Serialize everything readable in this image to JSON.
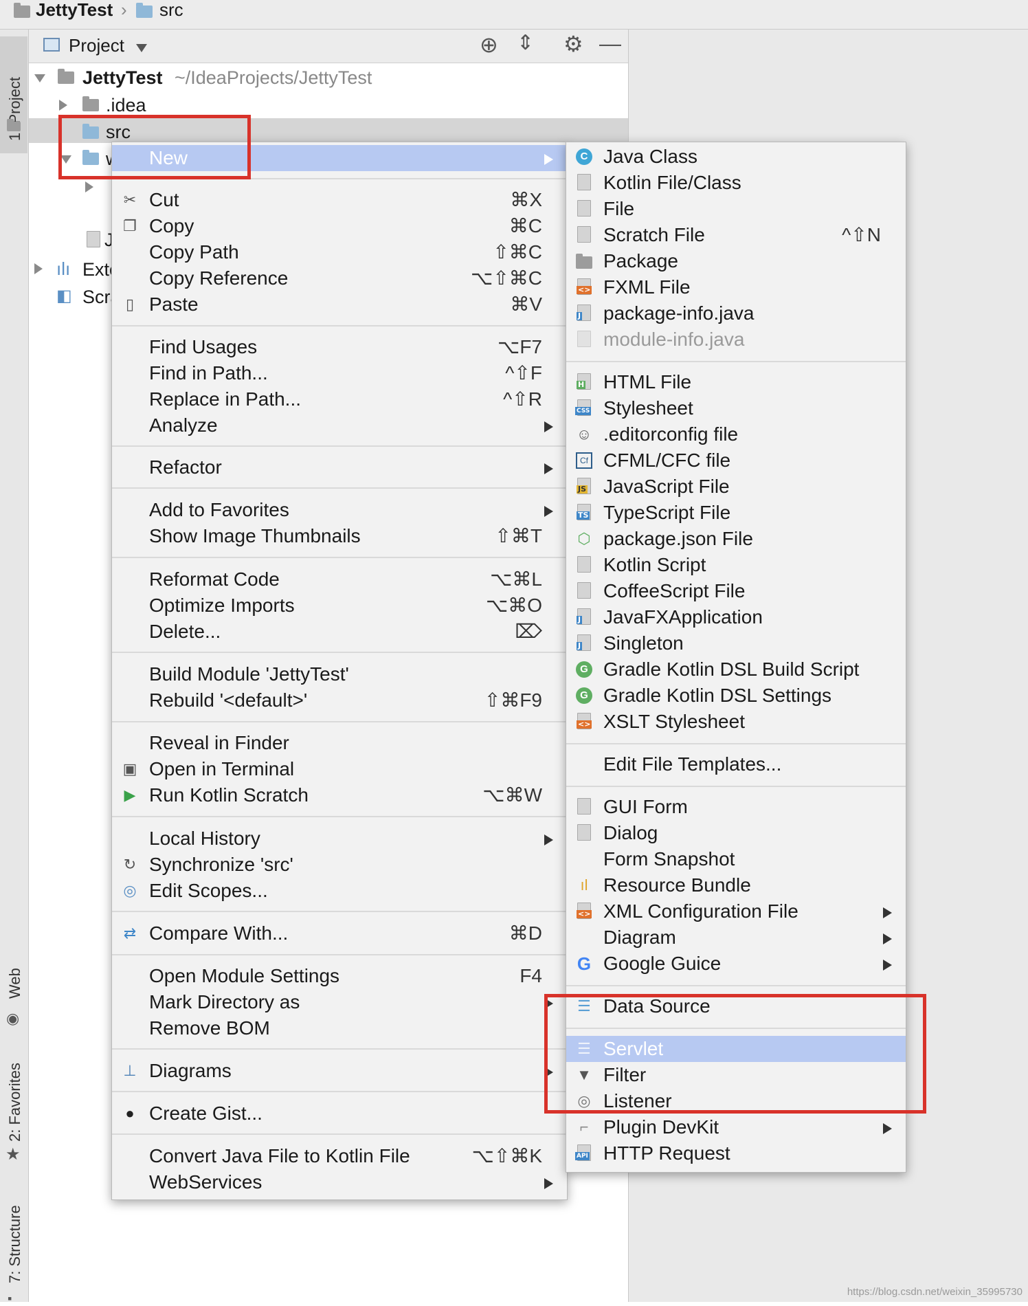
{
  "breadcrumb": {
    "project": "JettyTest",
    "folder": "src"
  },
  "tool_strip": {
    "project_tab": "1: Project",
    "web_tab": "Web",
    "favorites_tab": "2: Favorites",
    "structure_tab": "7: Structure"
  },
  "panel_header": {
    "title": "Project"
  },
  "tree": {
    "root_name": "JettyTest",
    "root_path": "~/IdeaProjects/JettyTest",
    "idea": ".idea",
    "src": "src",
    "partial_w": "w",
    "partial_j": "J",
    "external": "Exte",
    "scratches": "Scra"
  },
  "context_menu": {
    "new": "New",
    "cut": {
      "label": "Cut",
      "shortcut": "⌘X"
    },
    "copy": {
      "label": "Copy",
      "shortcut": "⌘C"
    },
    "copy_path": {
      "label": "Copy Path",
      "shortcut": "⇧⌘C"
    },
    "copy_reference": {
      "label": "Copy Reference",
      "shortcut": "⌥⇧⌘C"
    },
    "paste": {
      "label": "Paste",
      "shortcut": "⌘V"
    },
    "find_usages": {
      "label": "Find Usages",
      "shortcut": "⌥F7"
    },
    "find_in_path": {
      "label": "Find in Path...",
      "shortcut": "^⇧F"
    },
    "replace_in_path": {
      "label": "Replace in Path...",
      "shortcut": "^⇧R"
    },
    "analyze": "Analyze",
    "refactor": "Refactor",
    "add_to_favorites": "Add to Favorites",
    "show_image_thumbnails": {
      "label": "Show Image Thumbnails",
      "shortcut": "⇧⌘T"
    },
    "reformat_code": {
      "label": "Reformat Code",
      "shortcut": "⌥⌘L"
    },
    "optimize_imports": {
      "label": "Optimize Imports",
      "shortcut": "⌥⌘O"
    },
    "delete": {
      "label": "Delete...",
      "shortcut": "⌦"
    },
    "build_module": "Build Module 'JettyTest'",
    "rebuild": {
      "label": "Rebuild '<default>'",
      "shortcut": "⇧⌘F9"
    },
    "reveal_in_finder": "Reveal in Finder",
    "open_in_terminal": "Open in Terminal",
    "run_kotlin_scratch": {
      "label": "Run Kotlin Scratch",
      "shortcut": "⌥⌘W"
    },
    "local_history": "Local History",
    "synchronize": "Synchronize 'src'",
    "edit_scopes": "Edit Scopes...",
    "compare_with": {
      "label": "Compare With...",
      "shortcut": "⌘D"
    },
    "open_module_settings": {
      "label": "Open Module Settings",
      "shortcut": "F4"
    },
    "mark_directory_as": "Mark Directory as",
    "remove_bom": "Remove BOM",
    "diagrams": "Diagrams",
    "create_gist": "Create Gist...",
    "convert_java": {
      "label": "Convert Java File to Kotlin File",
      "shortcut": "⌥⇧⌘K"
    },
    "webservices": "WebServices"
  },
  "new_submenu": {
    "java_class": "Java Class",
    "kotlin_file_class": "Kotlin File/Class",
    "file": "File",
    "scratch_file": {
      "label": "Scratch File",
      "shortcut": "^⇧N"
    },
    "package": "Package",
    "fxml_file": "FXML File",
    "package_info": "package-info.java",
    "module_info": "module-info.java",
    "html_file": "HTML File",
    "stylesheet": "Stylesheet",
    "editorconfig": ".editorconfig file",
    "cfml": "CFML/CFC file",
    "javascript": "JavaScript File",
    "typescript": "TypeScript File",
    "package_json": "package.json File",
    "kotlin_script": "Kotlin Script",
    "coffeescript": "CoffeeScript File",
    "javafx": "JavaFXApplication",
    "singleton": "Singleton",
    "gradle_build": "Gradle Kotlin DSL Build Script",
    "gradle_settings": "Gradle Kotlin DSL Settings",
    "xslt": "XSLT Stylesheet",
    "edit_templates": "Edit File Templates...",
    "gui_form": "GUI Form",
    "dialog": "Dialog",
    "form_snapshot": "Form Snapshot",
    "resource_bundle": "Resource Bundle",
    "xml_config": "XML Configuration File",
    "diagram": "Diagram",
    "google_guice": "Google Guice",
    "data_source": "Data Source",
    "servlet": "Servlet",
    "filter": "Filter",
    "listener": "Listener",
    "plugin_devkit": "Plugin DevKit",
    "http_request": "HTTP Request"
  },
  "icon_glyphs": {
    "java_class": "C",
    "gradle": "G",
    "cfml": "Cf",
    "html": "H",
    "css": "CSS",
    "js": "JS",
    "ts": "TS",
    "api": "API",
    "fxml": "<>",
    "xml": "<>",
    "java": "J"
  },
  "colors": {
    "accent_selection": "#b7c9f2",
    "highlight_box": "#d8322a",
    "java_class": "#3fa6d6",
    "gradle": "#5fae62"
  },
  "watermark": "https://blog.csdn.net/weixin_35995730"
}
